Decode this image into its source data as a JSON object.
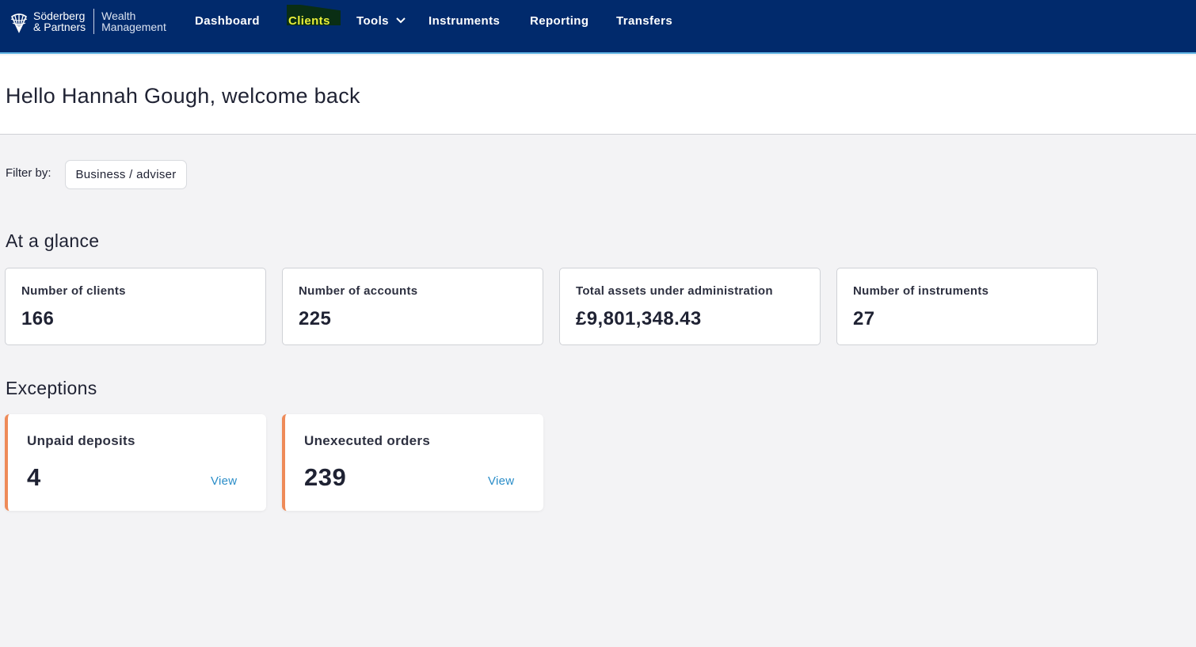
{
  "brand": {
    "name_line1": "Söderberg",
    "name_line2": "& Partners",
    "sub_line1": "Wealth",
    "sub_line2": "Management"
  },
  "nav": {
    "dashboard": "Dashboard",
    "clients": "Clients",
    "tools": "Tools",
    "instruments": "Instruments",
    "reporting": "Reporting",
    "transfers": "Transfers"
  },
  "greeting": "Hello Hannah Gough, welcome back",
  "filter": {
    "label": "Filter by:",
    "chip": "Business / adviser"
  },
  "glance": {
    "title": "At a glance",
    "cards": [
      {
        "label": "Number of clients",
        "value": "166"
      },
      {
        "label": "Number of accounts",
        "value": "225"
      },
      {
        "label": "Total assets under administration",
        "value": "£9,801,348.43"
      },
      {
        "label": "Number of instruments",
        "value": "27"
      }
    ]
  },
  "exceptions": {
    "title": "Exceptions",
    "cards": [
      {
        "label": "Unpaid deposits",
        "value": "4",
        "link": "View"
      },
      {
        "label": "Unexecuted orders",
        "value": "239",
        "link": "View"
      }
    ]
  },
  "colors": {
    "nav_bg": "#012a6c",
    "nav_accent": "#5fb4e4",
    "exception_accent": "#ee8a58",
    "link": "#2a8dc8",
    "highlight_text": "#e7ee3a"
  },
  "icons": {
    "logo": "shell-logo-icon",
    "tools_menu": "chevron-down-icon"
  }
}
